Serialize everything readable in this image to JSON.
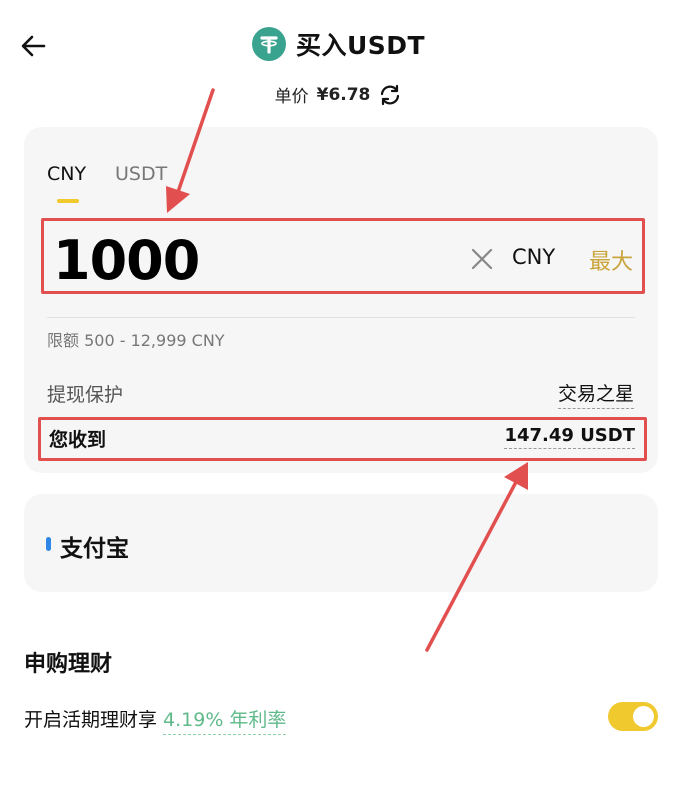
{
  "header": {
    "title": "买入USDT",
    "coin_icon": "tether-icon",
    "back_icon": "arrow-left-icon"
  },
  "price": {
    "label": "单价",
    "value": "¥6.78",
    "refresh_icon": "refresh-icon"
  },
  "amount_card": {
    "tabs": [
      {
        "label": "CNY",
        "active": true
      },
      {
        "label": "USDT",
        "active": false
      }
    ],
    "input_value": "1000",
    "unit": "CNY",
    "max_label": "最大",
    "limit_text": "限额 500 - 12,999 CNY",
    "protection_label": "提现保护",
    "protection_value": "交易之星",
    "receive_label": "您收到",
    "receive_value": "147.49 USDT"
  },
  "payment": {
    "method_label": "支付宝"
  },
  "earn": {
    "section_title": "申购理财",
    "text": "开启活期理财享",
    "rate": "4.19% 年利率",
    "toggle_on": true
  },
  "colors": {
    "accent_yellow": "#f0c92f",
    "max_gold": "#c9a43a",
    "annotation_red": "#e24f4f",
    "rate_green": "#5fb98a",
    "card_bg": "#f6f6f6",
    "tether_green": "#3aa38f"
  }
}
